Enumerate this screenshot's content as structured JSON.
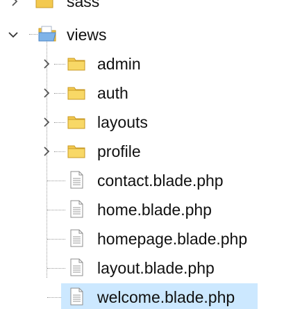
{
  "tree": {
    "partial": {
      "label": "sass",
      "icon": "folder-icon"
    },
    "parent": {
      "label": "views",
      "icon": "open-folder-icon",
      "expanded": true
    },
    "folders": [
      {
        "label": "admin",
        "icon": "folder-icon",
        "expanded": false
      },
      {
        "label": "auth",
        "icon": "folder-icon",
        "expanded": false
      },
      {
        "label": "layouts",
        "icon": "folder-icon",
        "expanded": false
      },
      {
        "label": "profile",
        "icon": "folder-icon",
        "expanded": false
      }
    ],
    "files": [
      {
        "label": "contact.blade.php",
        "icon": "file-icon"
      },
      {
        "label": "home.blade.php",
        "icon": "file-icon"
      },
      {
        "label": "homepage.blade.php",
        "icon": "file-icon"
      },
      {
        "label": "layout.blade.php",
        "icon": "file-icon"
      },
      {
        "label": "welcome.blade.php",
        "icon": "file-icon",
        "selected": true
      }
    ],
    "colors": {
      "selection": "#cce8ff",
      "folder": "#f3c94f",
      "connector": "#9a9a9a"
    }
  }
}
